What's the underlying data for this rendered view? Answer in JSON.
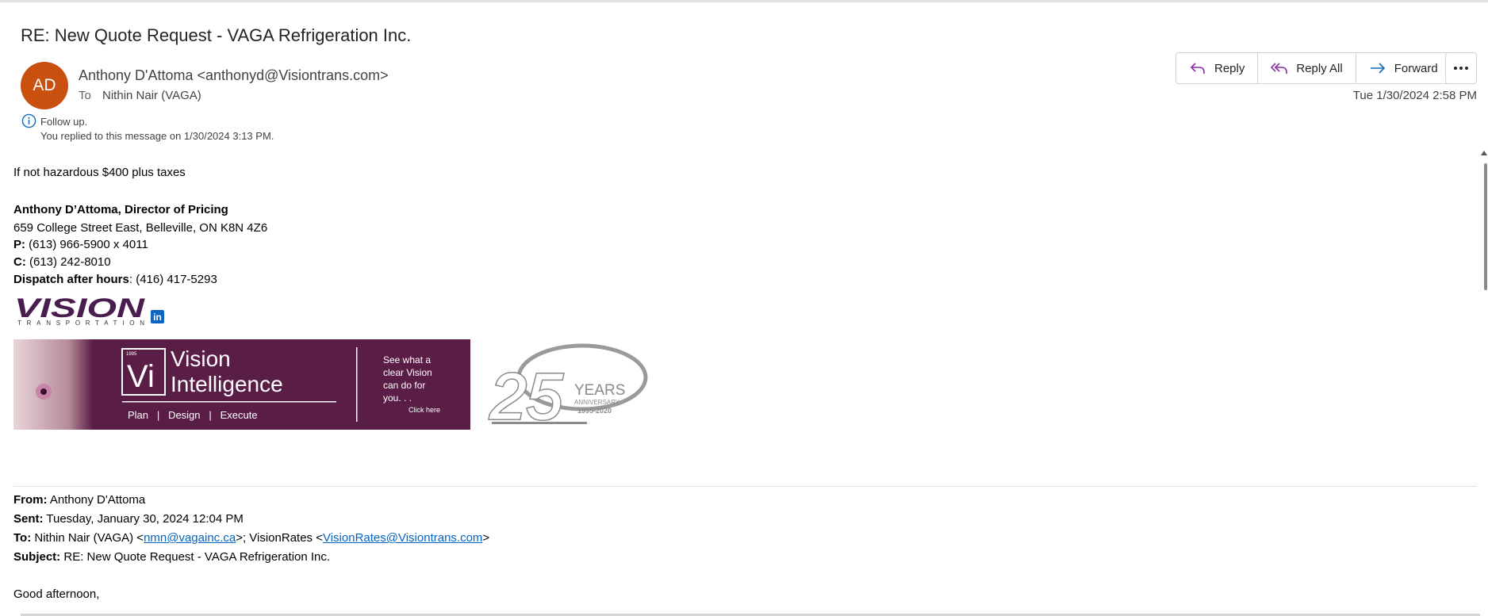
{
  "email": {
    "subject": "RE: New Quote Request - VAGA Refrigeration Inc.",
    "avatar_initials": "AD",
    "avatar_color": "#ca5010",
    "sender": "Anthony D'Attoma <anthonyd@Visiontrans.com>",
    "to_label": "To",
    "to": "Nithin Nair (VAGA)",
    "follow_up": "Follow up.",
    "replied_note": "You replied to this message on 1/30/2024 3:13 PM.",
    "date": "Tue 1/30/2024 2:58 PM"
  },
  "actions": {
    "reply": "Reply",
    "reply_all": "Reply All",
    "forward": "Forward",
    "more_icon": "more-horizontal-icon"
  },
  "body": {
    "line1": "If not hazardous $400 plus taxes",
    "sig_name": "Anthony D’Attoma, Director of Pricing",
    "sig_address": "659 College Street East, Belleville, ON  K8N 4Z6",
    "phone_label": "P:",
    "phone": " (613) 966-5900 x 4011",
    "cell_label": "C:",
    "cell": " (613) 242-8010",
    "dispatch_label": "Dispatch after hours",
    "dispatch": ": (416) 417-5293",
    "logo_text": "VISION",
    "logo_sub": "TRANSPORTATION",
    "linkedin_icon": "in",
    "banner": {
      "badge": "Vi",
      "badge_year": "1995",
      "title1": "Vision",
      "title2": "Intelligence",
      "tagline": "Plan   |   Design   |   Execute",
      "side1": "See what a",
      "side2": "clear Vision",
      "side3": "can do for",
      "side4": "you. . .",
      "cta": "Click here"
    },
    "anniversary": {
      "number": "25",
      "years": "YEARS",
      "label": "ANNIVERSARY",
      "range": "1995-2020"
    }
  },
  "quoted": {
    "from_label": "From:",
    "from": " Anthony D'Attoma",
    "sent_label": "Sent:",
    "sent": " Tuesday, January 30, 2024 12:04 PM",
    "to_label": "To:",
    "to_prefix": " Nithin Nair (VAGA) <",
    "to_email1": "nmn@vagainc.ca",
    "to_mid": ">; VisionRates <",
    "to_email2": "VisionRates@Visiontrans.com",
    "to_suffix": ">",
    "subject_label": "Subject:",
    "subject": " RE: New Quote Request - VAGA Refrigeration Inc.",
    "greeting": "Good afternoon,"
  }
}
